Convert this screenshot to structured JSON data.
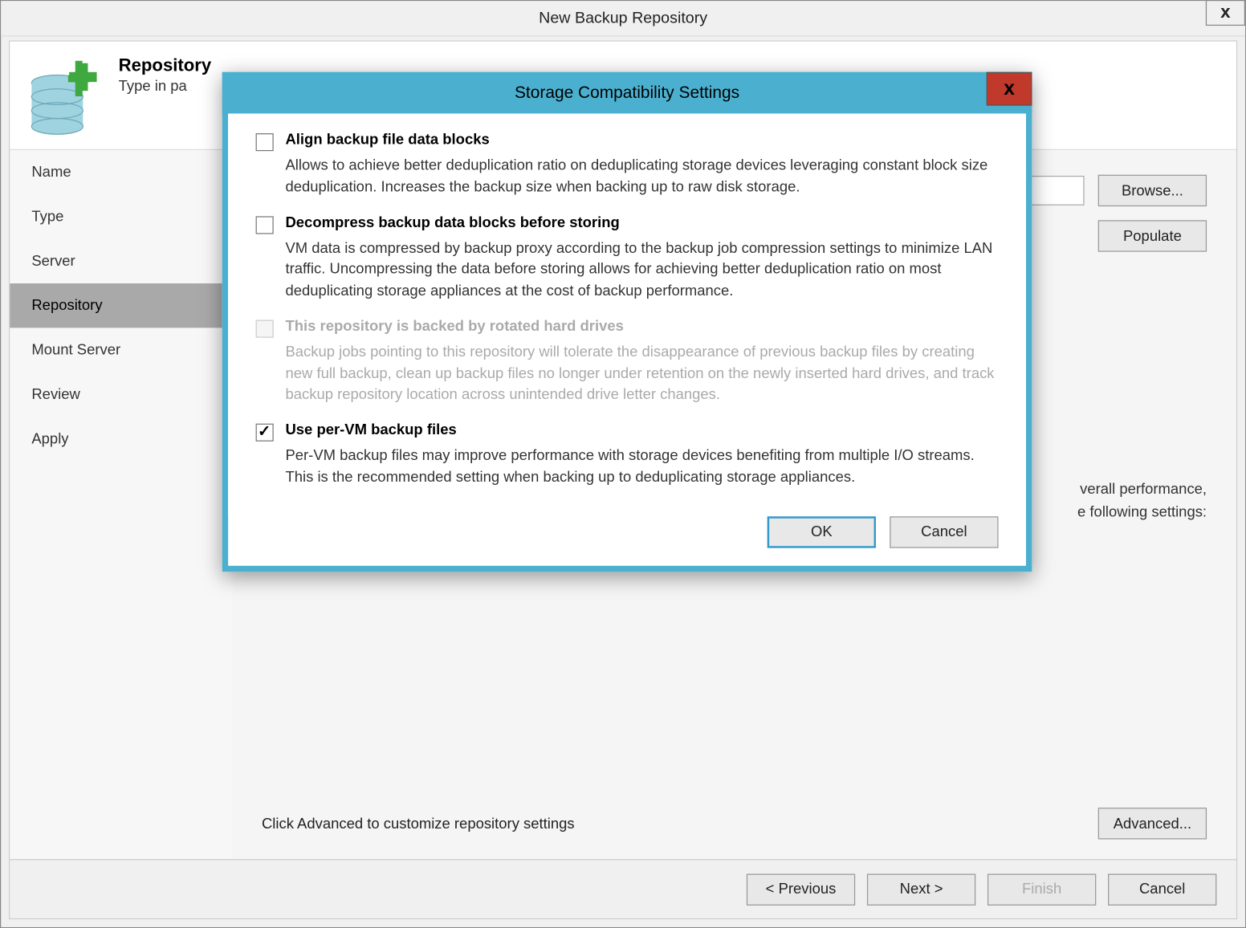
{
  "parent_window": {
    "title": "New Backup Repository",
    "close": "x"
  },
  "wizard_header": {
    "title": "Repository",
    "subtitle": "Type in pa"
  },
  "nav": {
    "items": [
      {
        "label": "Name"
      },
      {
        "label": "Type"
      },
      {
        "label": "Server"
      },
      {
        "label": "Repository"
      },
      {
        "label": "Mount Server"
      },
      {
        "label": "Review"
      },
      {
        "label": "Apply"
      }
    ],
    "selected_index": 3
  },
  "main": {
    "browse_btn": "Browse...",
    "populate_btn": "Populate",
    "info_line1": "verall performance,",
    "info_line2": "e following settings:",
    "advanced_hint": "Click Advanced to customize repository settings",
    "advanced_btn": "Advanced..."
  },
  "footer": {
    "previous": "< Previous",
    "next": "Next >",
    "finish": "Finish",
    "cancel": "Cancel"
  },
  "modal": {
    "title": "Storage Compatibility Settings",
    "close": "x",
    "options": [
      {
        "label": "Align backup file data blocks",
        "desc": "Allows to achieve better deduplication ratio on deduplicating storage devices leveraging constant block size deduplication. Increases the backup size when backing up to raw disk storage.",
        "checked": false,
        "disabled": false
      },
      {
        "label": "Decompress backup data blocks before storing",
        "desc": "VM data is compressed by backup proxy according to the backup job compression settings to minimize LAN traffic. Uncompressing the data before storing allows for achieving better deduplication ratio on most deduplicating storage appliances at the cost of backup performance.",
        "checked": false,
        "disabled": false
      },
      {
        "label": "This repository is backed by rotated hard drives",
        "desc": "Backup jobs pointing to this repository will tolerate the disappearance of previous backup files by creating new full backup, clean up backup files no longer under retention on the newly inserted hard drives, and track backup repository location across unintended drive letter changes.",
        "checked": false,
        "disabled": true
      },
      {
        "label": "Use per-VM backup files",
        "desc": "Per-VM backup files may improve performance with storage devices benefiting from multiple I/O streams. This is the recommended setting when backing up to deduplicating storage appliances.",
        "checked": true,
        "disabled": false
      }
    ],
    "ok": "OK",
    "cancel": "Cancel"
  }
}
